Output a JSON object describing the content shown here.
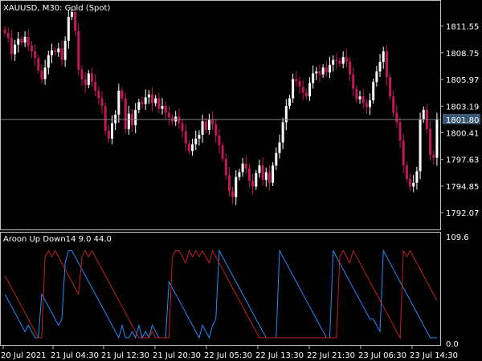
{
  "window": {
    "symbol_title": "XAUUSD, M30:  Gold (Spot)",
    "current_price": "1801.80",
    "indicator_title": "Aroon Up Down14 9.0 44.0"
  },
  "colors": {
    "background": "#000000",
    "frame": "#c0c0c0",
    "bull": "#ffffff",
    "bear": "#c2185b",
    "aroon_up": "#1e90ff",
    "aroon_down": "#c61f1f",
    "current_line": "#808080",
    "current_box": "#3a5773"
  },
  "price_axis": [
    "1811.55",
    "1808.75",
    "1805.97",
    "1803.19",
    "1800.41",
    "1797.63",
    "1794.85",
    "1792.07"
  ],
  "indicator_axis": [
    "109.6",
    "0.0"
  ],
  "time_axis": [
    "20 Jul 2021",
    "21 Jul 04:30",
    "21 Jul 12:30",
    "21 Jul 20:30",
    "22 Jul 05:30",
    "22 Jul 13:30",
    "22 Jul 21:30",
    "23 Jul 06:30",
    "23 Jul 14:30"
  ],
  "chart_data": [
    {
      "type": "candlestick",
      "title": "XAUUSD, M30:  Gold (Spot)",
      "ylim": [
        1790.5,
        1814.0
      ],
      "y_ticks": [
        1811.55,
        1808.75,
        1805.97,
        1803.19,
        1800.41,
        1797.63,
        1794.85,
        1792.07
      ],
      "current_price": 1801.8,
      "close": [
        1810.8,
        1810.3,
        1808.6,
        1809.6,
        1810.2,
        1809.8,
        1810.4,
        1809.5,
        1808.9,
        1808.2,
        1806.9,
        1806.0,
        1807.2,
        1808.5,
        1809.0,
        1808.8,
        1809.2,
        1808.0,
        1810.0,
        1812.5,
        1813.0,
        1811.0,
        1807.0,
        1806.0,
        1805.4,
        1806.6,
        1805.7,
        1804.8,
        1804.0,
        1803.2,
        1800.6,
        1799.8,
        1801.4,
        1802.3,
        1804.8,
        1804.0,
        1800.8,
        1802.4,
        1801.2,
        1802.8,
        1803.6,
        1803.4,
        1804.1,
        1804.4,
        1803.5,
        1804.0,
        1802.9,
        1803.2,
        1802.5,
        1802.0,
        1801.6,
        1802.1,
        1801.4,
        1800.6,
        1799.3,
        1798.5,
        1799.2,
        1799.8,
        1800.2,
        1801.6,
        1800.7,
        1801.8,
        1801.3,
        1800.1,
        1799.1,
        1797.7,
        1796.0,
        1794.3,
        1793.7,
        1795.8,
        1796.3,
        1797.2,
        1796.7,
        1795.4,
        1794.8,
        1796.2,
        1797.0,
        1795.5,
        1796.3,
        1795.2,
        1797.0,
        1798.3,
        1799.4,
        1801.5,
        1803.2,
        1804.0,
        1806.0,
        1805.8,
        1805.2,
        1804.6,
        1804.2,
        1805.6,
        1806.6,
        1806.8,
        1806.5,
        1807.2,
        1806.7,
        1807.5,
        1808.0,
        1807.9,
        1807.6,
        1808.3,
        1807.8,
        1806.5,
        1805.0,
        1803.9,
        1804.2,
        1803.5,
        1803.1,
        1803.8,
        1805.7,
        1806.8,
        1807.8,
        1808.9,
        1806.2,
        1804.2,
        1802.5,
        1801.5,
        1799.6,
        1797.0,
        1795.6,
        1794.8,
        1795.2,
        1796.4,
        1801.8,
        1802.8,
        1800.8,
        1798.1,
        1797.8,
        1801.8
      ]
    },
    {
      "type": "line",
      "title": "Aroon Up Down14 9.0 44.0",
      "ylim": [
        0.0,
        109.6
      ],
      "series": [
        {
          "color": "#1e90ff",
          "values": [
            50.0,
            42.9,
            35.7,
            28.6,
            21.4,
            14.3,
            7.1,
            14.3,
            7.1,
            0.0,
            0.0,
            50.0,
            42.9,
            35.7,
            28.6,
            21.4,
            14.3,
            21.4,
            85.7,
            100.0,
            100.0,
            92.9,
            85.7,
            78.6,
            71.4,
            64.3,
            57.1,
            50.0,
            42.9,
            35.7,
            28.6,
            21.4,
            14.3,
            7.1,
            0.0,
            14.3,
            0.0,
            0.0,
            7.1,
            0.0,
            14.3,
            0.0,
            7.1,
            0.0,
            14.3,
            7.1,
            0.0,
            0.0,
            0.0,
            64.3,
            57.1,
            50.0,
            42.9,
            35.7,
            28.6,
            21.4,
            14.3,
            7.1,
            0.0,
            14.3,
            7.1,
            0.0,
            14.3,
            21.4,
            100.0,
            92.9,
            85.7,
            78.6,
            71.4,
            64.3,
            57.1,
            50.0,
            42.9,
            35.7,
            28.6,
            21.4,
            14.3,
            7.1,
            0.0,
            0.0,
            0.0,
            0.0,
            100.0,
            92.9,
            85.7,
            78.6,
            71.4,
            64.3,
            57.1,
            50.0,
            42.9,
            35.7,
            28.6,
            21.4,
            14.3,
            7.1,
            0.0,
            0.0,
            100.0,
            92.9,
            85.7,
            78.6,
            71.4,
            64.3,
            57.1,
            50.0,
            42.9,
            35.7,
            28.6,
            21.4,
            21.4,
            14.3,
            7.1,
            100.0,
            92.9,
            85.7,
            78.6,
            71.4,
            64.3,
            57.1,
            50.0,
            42.9,
            35.7,
            28.6,
            21.4,
            14.3,
            7.1,
            0.0,
            0.0,
            0.0
          ]
        },
        {
          "color": "#c61f1f",
          "values": [
            71.4,
            64.3,
            57.1,
            50.0,
            42.9,
            35.7,
            28.6,
            21.4,
            14.3,
            7.1,
            0.0,
            0.0,
            92.9,
            100.0,
            92.9,
            100.0,
            92.9,
            85.7,
            78.6,
            71.4,
            64.3,
            57.1,
            50.0,
            92.9,
            100.0,
            92.9,
            100.0,
            92.9,
            85.7,
            78.6,
            71.4,
            64.3,
            57.1,
            50.0,
            42.9,
            35.7,
            28.6,
            21.4,
            14.3,
            7.1,
            0.0,
            0.0,
            0.0,
            0.0,
            7.1,
            0.0,
            0.0,
            0.0,
            0.0,
            0.0,
            92.9,
            100.0,
            100.0,
            92.9,
            85.7,
            100.0,
            92.9,
            100.0,
            92.9,
            100.0,
            92.9,
            85.7,
            100.0,
            92.9,
            85.7,
            78.6,
            71.4,
            64.3,
            57.1,
            50.0,
            42.9,
            35.7,
            28.6,
            21.4,
            14.3,
            7.1,
            0.0,
            0.0,
            0.0,
            0.0,
            0.0,
            0.0,
            0.0,
            0.0,
            0.0,
            0.0,
            0.0,
            0.0,
            0.0,
            0.0,
            0.0,
            0.0,
            0.0,
            0.0,
            0.0,
            0.0,
            0.0,
            0.0,
            0.0,
            0.0,
            92.9,
            100.0,
            92.9,
            85.7,
            100.0,
            92.9,
            85.7,
            78.6,
            71.4,
            64.3,
            57.1,
            50.0,
            42.9,
            35.7,
            28.6,
            21.4,
            14.3,
            7.1,
            0.0,
            100.0,
            92.9,
            100.0,
            92.9,
            85.7,
            78.6,
            71.4,
            64.3,
            57.1,
            50.0,
            42.9
          ]
        }
      ]
    }
  ]
}
